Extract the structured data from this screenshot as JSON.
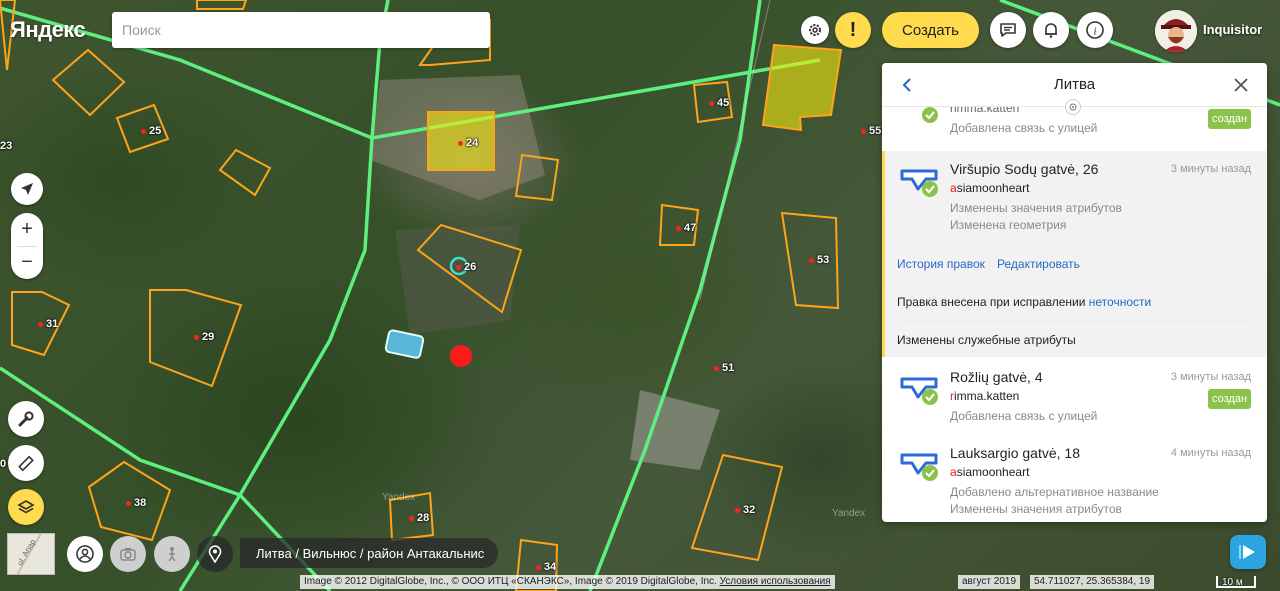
{
  "header": {
    "logo": "Яндекс",
    "search_placeholder": "Поиск",
    "create_label": "Создать",
    "username": "Inquisitor",
    "icons": [
      "gear-icon",
      "alert-icon",
      "chat-icon",
      "bell-icon",
      "info-icon"
    ]
  },
  "colors": {
    "accent_yellow": "#ffdb4d",
    "badge_green": "#8bc34a",
    "link_blue": "#2767c8",
    "lot_outline": "#ffa31a",
    "road_green": "#5df07e",
    "selected_yellow": "#f5ea0f"
  },
  "map": {
    "lots": [
      {
        "label": "24"
      },
      {
        "label": "25"
      },
      {
        "label": "26"
      },
      {
        "label": "29"
      },
      {
        "label": "31"
      },
      {
        "label": "45"
      },
      {
        "label": "47"
      },
      {
        "label": "53"
      },
      {
        "label": "55"
      },
      {
        "label": "51"
      },
      {
        "label": "38"
      },
      {
        "label": "28"
      },
      {
        "label": "32"
      },
      {
        "label": "34"
      },
      {
        "label": "23"
      },
      {
        "label": "0"
      }
    ],
    "watermarks": [
      "Yandex",
      "Yandex"
    ]
  },
  "panel": {
    "title": "Литва",
    "entries": [
      {
        "title": "",
        "user": "rimma.katten",
        "time": "",
        "lines": [
          "Добавлена связь с улицей"
        ],
        "badge": "создан"
      },
      {
        "title": "Viršupio Sodų gatvė, 26",
        "user_first": "a",
        "user_rest": "siamoonheart",
        "time": "3 минуты назад",
        "lines": [
          "Изменены значения атрибутов",
          "Изменена геометрия"
        ],
        "actions": [
          "История правок",
          "Редактировать"
        ],
        "note_prefix": "Правка внесена при исправлении ",
        "note_link": "неточности",
        "service_note": "Изменены служебные атрибуты"
      },
      {
        "title": "Rožlių gatvė, 4",
        "user_first": "r",
        "user_rest": "imma.katten",
        "time": "3 минуты назад",
        "lines": [
          "Добавлена связь с улицей"
        ],
        "badge": "создан"
      },
      {
        "title": "Lauksargio gatvė, 18",
        "user_first": "a",
        "user_rest": "siamoonheart",
        "time": "4 минуты назад",
        "lines": [
          "Добавлено альтернативное название",
          "Изменены значения атрибутов"
        ]
      }
    ]
  },
  "bottom": {
    "breadcrumb": "Литва / Вильнюс / район Антакальнис",
    "copyright": "Image © 2012 DigitalGlobe, Inc., © ООО ИТЦ «СКАНЭКС», Image © 2019 DigitalGlobe, Inc.",
    "terms": "Условия использования",
    "date": "август 2019",
    "coords": "54.711027, 25.365384, 19",
    "scale": "10 м",
    "minimap_label": "ul. Anap"
  }
}
